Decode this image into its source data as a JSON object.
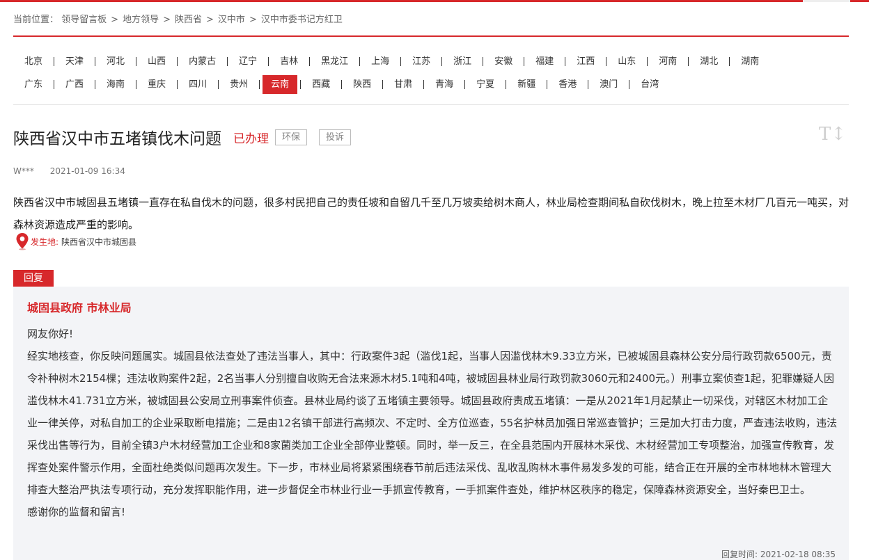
{
  "breadcrumb": {
    "prefix": "当前位置：",
    "items": [
      "领导留言板",
      "地方领导",
      "陕西省",
      "汉中市",
      "汉中市委书记方红卫"
    ],
    "separator": ">"
  },
  "regions": {
    "row1": [
      "北京",
      "天津",
      "河北",
      "山西",
      "内蒙古",
      "辽宁",
      "吉林",
      "黑龙江",
      "上海",
      "江苏",
      "浙江",
      "安徽",
      "福建",
      "江西",
      "山东",
      "河南",
      "湖北",
      "湖南"
    ],
    "row2": [
      "广东",
      "广西",
      "海南",
      "重庆",
      "四川",
      "贵州",
      "云南",
      "西藏",
      "陕西",
      "甘肃",
      "青海",
      "宁夏",
      "新疆",
      "香港",
      "澳门",
      "台湾"
    ],
    "active": "云南"
  },
  "message": {
    "title": "陕西省汉中市五堵镇伐木问题",
    "status": "已办理",
    "tags": [
      "环保",
      "投诉"
    ],
    "author": "W***",
    "date": "2021-01-09 16:34",
    "body": "陕西省汉中市城固县五堵镇一直存在私自伐木的问题，很多村民把自己的责任坡和自留几千至几万坡卖给树木商人，林业局检查期间私自砍伐树木，晚上拉至木材厂几百元一吨买，对森林资源造成严重的影响。",
    "location_label": "发生地:",
    "location": "陕西省汉中市城固县",
    "font_toggle": "T↕"
  },
  "reply": {
    "tab_label": "回复",
    "org": "城固县政府 市林业局",
    "greeting": "网友你好!",
    "content": "经实地核查，你反映问题属实。城固县依法查处了违法当事人，其中：行政案件3起（滥伐1起，当事人因滥伐林木9.33立方米，已被城固县森林公安分局行政罚款6500元，责令补种树木2154棵；违法收购案件2起，2名当事人分别擅自收购无合法来源木材5.1吨和4吨，被城固县林业局行政罚款3060元和2400元。）刑事立案侦查1起，犯罪嫌疑人因滥伐林木41.731立方米，被城固县公安局立刑事案件侦查。县林业局约谈了五堵镇主要领导。城固县政府责成五堵镇：一是从2021年1月起禁止一切采伐，对辖区木材加工企业一律关停，对私自加工的企业采取断电措施；二是由12名镇干部进行高频次、不定时、全方位巡查，55名护林员加强日常巡查管护；三是加大打击力度，严查违法收购，违法采伐出售等行为，目前全镇3户木材经营加工企业和8家菌类加工企业全部停业整顿。同时，举一反三，在全县范围内开展林木采伐、木材经营加工专项整治，加强宣传教育，发挥查处案件警示作用，全面杜绝类似问题再次发生。下一步，市林业局将紧紧围绕春节前后违法采伐、乱收乱购林木事件易发多发的可能，结合正在开展的全市林地林木管理大排查大整治严执法专项行动，充分发挥职能作用，进一步督促全市林业行业一手抓宣传教育，一手抓案件查处，维护林区秩序的稳定，保障森林资源安全，当好秦巴卫士。",
    "closing": "感谢你的监督和留言!",
    "time_label": "回复时间:",
    "time": "2021-02-18 08:35"
  },
  "colors": {
    "accent": "#d7282b",
    "reply_bg": "#f3f4f7"
  }
}
